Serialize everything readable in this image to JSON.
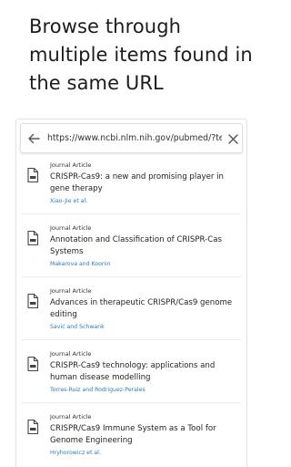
{
  "headline": {
    "line1": "Browse through",
    "line2": "multiple items found in",
    "line3": "the same URL"
  },
  "urlbar": {
    "url": "https://www.ncbi.nlm.nih.gov/pubmed/?term"
  },
  "icons": {
    "back": "arrow-left-icon",
    "close": "close-icon",
    "document": "document-icon"
  },
  "colors": {
    "author_link": "#2b7bb5"
  },
  "items": [
    {
      "type": "Journal Article",
      "title": "CRISPR-Cas9: a new and promising player in gene therapy",
      "authors": "Xiao-Jie et al."
    },
    {
      "type": "Journal Article",
      "title": "Annotation and Classification of CRISPR-Cas Systems",
      "authors": "Makarova and Koonin"
    },
    {
      "type": "Journal Article",
      "title": "Advances in therapeutic CRISPR/Cas9 genome editing",
      "authors": "Savić and Schwank"
    },
    {
      "type": "Journal Article",
      "title": "CRISPR-Cas9 technology: applications and human disease modelling",
      "authors": "Torres-Ruiz and Rodriguez-Perales"
    },
    {
      "type": "Journal Article",
      "title": "CRISPR/Cas9 Immune System as a Tool for Genome Engineering",
      "authors": "Hryhorowicz et al."
    }
  ]
}
